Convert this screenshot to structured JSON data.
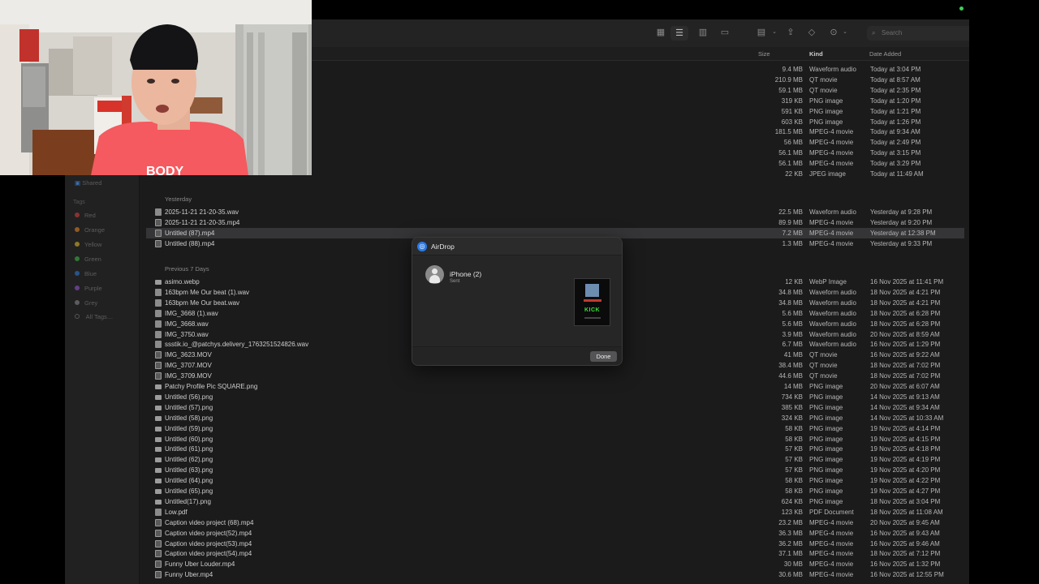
{
  "toolbar": {
    "search_placeholder": "Search"
  },
  "columns": {
    "size": "Size",
    "kind": "Kind",
    "date_added": "Date Added"
  },
  "sidebar": {
    "shared": "Shared",
    "tags_header": "Tags",
    "tags": [
      {
        "label": "Red",
        "color": "#e0443e"
      },
      {
        "label": "Orange",
        "color": "#f08a24"
      },
      {
        "label": "Yellow",
        "color": "#e6c229"
      },
      {
        "label": "Green",
        "color": "#3fbf4a"
      },
      {
        "label": "Blue",
        "color": "#2f7fe0"
      },
      {
        "label": "Purple",
        "color": "#9b59d6"
      },
      {
        "label": "Grey",
        "color": "#8e8e93"
      }
    ],
    "all_tags": "All Tags…"
  },
  "today_rows": [
    {
      "size": "9.4 MB",
      "kind": "Waveform audio",
      "date": "Today at 3:04 PM"
    },
    {
      "size": "210.9 MB",
      "kind": "QT movie",
      "date": "Today at 8:57 AM"
    },
    {
      "size": "59.1 MB",
      "kind": "QT movie",
      "date": "Today at 2:35 PM"
    },
    {
      "size": "319 KB",
      "kind": "PNG image",
      "date": "Today at 1:20 PM"
    },
    {
      "size": "591 KB",
      "kind": "PNG image",
      "date": "Today at 1:21 PM"
    },
    {
      "size": "603 KB",
      "kind": "PNG image",
      "date": "Today at 1:26 PM"
    },
    {
      "size": "181.5 MB",
      "kind": "MPEG-4 movie",
      "date": "Today at 9:34 AM"
    },
    {
      "size": "56 MB",
      "kind": "MPEG-4 movie",
      "date": "Today at 2:49 PM"
    },
    {
      "size": "56.1 MB",
      "kind": "MPEG-4 movie",
      "date": "Today at 3:15 PM"
    },
    {
      "size": "56.1 MB",
      "kind": "MPEG-4 movie",
      "date": "Today at 3:29 PM"
    },
    {
      "size": "22 KB",
      "kind": "JPEG image",
      "date": "Today at 11:49 AM"
    }
  ],
  "yesterday_header": "Yesterday",
  "yesterday_rows": [
    {
      "name": "2025-11-21 21-20-35.wav",
      "size": "22.5 MB",
      "kind": "Waveform audio",
      "date": "Yesterday at 9:28 PM"
    },
    {
      "name": "2025-11-21 21-20-35.mp4",
      "size": "89.9 MB",
      "kind": "MPEG-4 movie",
      "date": "Yesterday at 9:20 PM"
    },
    {
      "name": "Untitled (87).mp4",
      "size": "7.2 MB",
      "kind": "MPEG-4 movie",
      "date": "Yesterday at 12:38 PM"
    },
    {
      "name": "Untitled (88).mp4",
      "size": "1.3 MB",
      "kind": "MPEG-4 movie",
      "date": "Yesterday at 9:33 PM"
    }
  ],
  "prev7_header": "Previous 7 Days",
  "prev7_rows": [
    {
      "name": "asimo.webp",
      "size": "12 KB",
      "kind": "WebP Image",
      "date": "16 Nov 2025 at 11:41 PM"
    },
    {
      "name": "163bpm Me Our beat (1).wav",
      "size": "34.8 MB",
      "kind": "Waveform audio",
      "date": "18 Nov 2025 at 4:21 PM"
    },
    {
      "name": "163bpm Me Our beat.wav",
      "size": "34.8 MB",
      "kind": "Waveform audio",
      "date": "18 Nov 2025 at 4:21 PM"
    },
    {
      "name": "IMG_3668 (1).wav",
      "size": "5.6 MB",
      "kind": "Waveform audio",
      "date": "18 Nov 2025 at 6:28 PM"
    },
    {
      "name": "IMG_3668.wav",
      "size": "5.6 MB",
      "kind": "Waveform audio",
      "date": "18 Nov 2025 at 6:28 PM"
    },
    {
      "name": "IMG_3750.wav",
      "size": "3.9 MB",
      "kind": "Waveform audio",
      "date": "20 Nov 2025 at 8:59 AM"
    },
    {
      "name": "ssstik.io_@patchys.delivery_1763251524826.wav",
      "size": "6.7 MB",
      "kind": "Waveform audio",
      "date": "16 Nov 2025 at 1:29 PM"
    },
    {
      "name": "IMG_3623.MOV",
      "size": "41 MB",
      "kind": "QT movie",
      "date": "16 Nov 2025 at 9:22 AM"
    },
    {
      "name": "IMG_3707.MOV",
      "size": "38.4 MB",
      "kind": "QT movie",
      "date": "18 Nov 2025 at 7:02 PM"
    },
    {
      "name": "IMG_3709.MOV",
      "size": "44.6 MB",
      "kind": "QT movie",
      "date": "18 Nov 2025 at 7:02 PM"
    },
    {
      "name": "Patchy Profile Pic SQUARE.png",
      "size": "14 MB",
      "kind": "PNG image",
      "date": "20 Nov 2025 at 6:07 AM"
    },
    {
      "name": "Untitled (56).png",
      "size": "734 KB",
      "kind": "PNG image",
      "date": "14 Nov 2025 at 9:13 AM"
    },
    {
      "name": "Untitled (57).png",
      "size": "385 KB",
      "kind": "PNG image",
      "date": "14 Nov 2025 at 9:34 AM"
    },
    {
      "name": "Untitled (58).png",
      "size": "324 KB",
      "kind": "PNG image",
      "date": "14 Nov 2025 at 10:33 AM"
    },
    {
      "name": "Untitled (59).png",
      "size": "58 KB",
      "kind": "PNG image",
      "date": "19 Nov 2025 at 4:14 PM"
    },
    {
      "name": "Untitled (60).png",
      "size": "58 KB",
      "kind": "PNG image",
      "date": "19 Nov 2025 at 4:15 PM"
    },
    {
      "name": "Untitled (61).png",
      "size": "57 KB",
      "kind": "PNG image",
      "date": "19 Nov 2025 at 4:18 PM"
    },
    {
      "name": "Untitled (62).png",
      "size": "57 KB",
      "kind": "PNG image",
      "date": "19 Nov 2025 at 4:19 PM"
    },
    {
      "name": "Untitled (63).png",
      "size": "57 KB",
      "kind": "PNG image",
      "date": "19 Nov 2025 at 4:20 PM"
    },
    {
      "name": "Untitled (64).png",
      "size": "58 KB",
      "kind": "PNG image",
      "date": "19 Nov 2025 at 4:22 PM"
    },
    {
      "name": "Untitled (65).png",
      "size": "58 KB",
      "kind": "PNG image",
      "date": "19 Nov 2025 at 4:27 PM"
    },
    {
      "name": "Untitled(17).png",
      "size": "624 KB",
      "kind": "PNG image",
      "date": "18 Nov 2025 at 3:04 PM"
    },
    {
      "name": "Low.pdf",
      "size": "123 KB",
      "kind": "PDF Document",
      "date": "18 Nov 2025 at 11:08 AM"
    },
    {
      "name": "Caption video project (68).mp4",
      "size": "23.2 MB",
      "kind": "MPEG-4 movie",
      "date": "20 Nov 2025 at 9:45 AM"
    },
    {
      "name": "Caption video project(52).mp4",
      "size": "36.3 MB",
      "kind": "MPEG-4 movie",
      "date": "16 Nov 2025 at 9:43 AM"
    },
    {
      "name": "Caption video project(53).mp4",
      "size": "36.2 MB",
      "kind": "MPEG-4 movie",
      "date": "16 Nov 2025 at 9:46 AM"
    },
    {
      "name": "Caption video project(54).mp4",
      "size": "37.1 MB",
      "kind": "MPEG-4 movie",
      "date": "18 Nov 2025 at 7:12 PM"
    },
    {
      "name": "Funny Uber Louder.mp4",
      "size": "30 MB",
      "kind": "MPEG-4 movie",
      "date": "16 Nov 2025 at 1:32 PM"
    },
    {
      "name": "Funny Uber.mp4",
      "size": "30.6 MB",
      "kind": "MPEG-4 movie",
      "date": "16 Nov 2025 at 12:55 PM"
    }
  ],
  "airdrop": {
    "title": "AirDrop",
    "device_name": "iPhone (2)",
    "status": "Sent",
    "thumb_text": "KICK",
    "done_label": "Done"
  },
  "webcam": {
    "shirt_text": "BODY"
  }
}
